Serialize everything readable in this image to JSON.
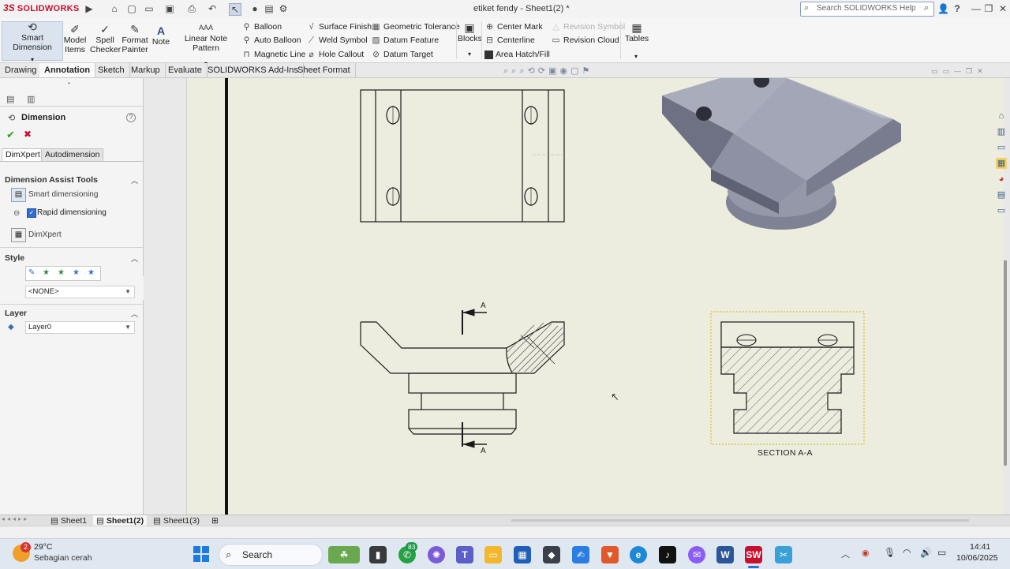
{
  "app": {
    "logo_ds": "3S",
    "logo_name": "SOLIDWORKS",
    "doc_title": "etiket fendy - Sheet1(2) *",
    "search_placeholder": "Search SOLIDWORKS Help",
    "help_label": "?"
  },
  "ribbon": {
    "smart_dimension": "Smart Dimension",
    "model_items": [
      "Model",
      "Items"
    ],
    "spell_checker": [
      "Spell",
      "Checker"
    ],
    "format_painter": [
      "Format",
      "Painter"
    ],
    "note": "Note",
    "linear_note_pattern": "Linear Note Pattern",
    "balloon": "Balloon",
    "auto_balloon": "Auto Balloon",
    "magnetic_line": "Magnetic Line",
    "surface_finish": "Surface Finish",
    "weld_symbol": "Weld Symbol",
    "hole_callout": "Hole Callout",
    "geometric_tolerance": "Geometric Tolerance",
    "datum_feature": "Datum Feature",
    "datum_target": "Datum Target",
    "blocks": "Blocks",
    "center_mark": "Center Mark",
    "centerline": "Centerline",
    "area_hatch": "Area Hatch/Fill",
    "revision_symbol": "Revision Symbol",
    "revision_cloud": "Revision Cloud",
    "tables": "Tables"
  },
  "tabs": [
    "Drawing",
    "Annotation",
    "Sketch",
    "Markup",
    "Evaluate",
    "SOLIDWORKS Add-Ins",
    "Sheet Format"
  ],
  "active_tab": "Annotation",
  "panel": {
    "title": "Dimension",
    "subtabs": [
      "DimXpert",
      "Autodimension"
    ],
    "assist_title": "Dimension Assist Tools",
    "smart_dimensioning": "Smart dimensioning",
    "rapid_dimensioning": "Rapid dimensioning",
    "dimxpert": "DimXpert",
    "style_title": "Style",
    "style_value": "<NONE>",
    "layer_title": "Layer",
    "layer_value": "Layer0"
  },
  "drawing": {
    "section_marker_top": "A",
    "section_marker_bottom": "A",
    "section_label": "SECTION A-A"
  },
  "sheet_tabs": [
    "Sheet1",
    "Sheet1(2)",
    "Sheet1(3)"
  ],
  "active_sheet": "Sheet1(2)",
  "taskbar": {
    "weather_temp": "29°C",
    "weather_desc": "Sebagian cerah",
    "weather_badge": "2",
    "search": "Search",
    "whatsapp_badge": "83",
    "time": "14:41",
    "date": "10/06/2025"
  },
  "colors": {
    "brand_red": "#c8102e",
    "canvas": "#ececdf",
    "model_gray": "#8e91a3"
  }
}
